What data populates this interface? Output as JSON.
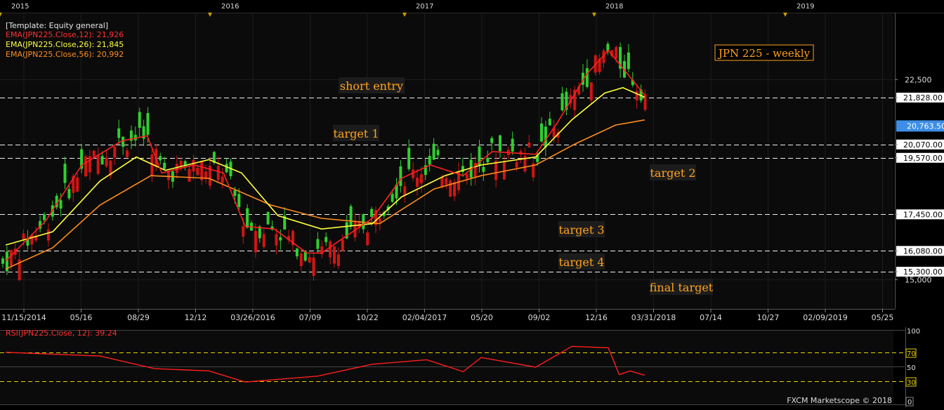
{
  "years": [
    {
      "label": "2015",
      "x": 0
    },
    {
      "label": "2016",
      "x": 299
    },
    {
      "label": "2017",
      "x": 576
    },
    {
      "label": "2018",
      "x": 846
    },
    {
      "label": "2019",
      "x": 1118
    }
  ],
  "legend": {
    "template": "[Template: Equity general]",
    "ema12": "EMA(JPN225.Close,12): 21,926",
    "ema26": "EMA(JPN225.Close,26): 21,845",
    "ema56": "EMA(JPN225.Close,56): 20,992"
  },
  "chart_title": "JPN 225 - weekly",
  "annotations": {
    "short_entry": "short entry",
    "target1": "target 1",
    "target2": "target 2",
    "target3": "target 3",
    "target4": "target 4",
    "final_target": "final target"
  },
  "price_axis": {
    "labels": [
      {
        "text": "22,500",
        "value": 22500
      },
      {
        "text": "21,828.00",
        "value": 21828
      },
      {
        "text": "20,070.00",
        "value": 20070
      },
      {
        "text": "19,570.00",
        "value": 19570
      },
      {
        "text": "17,450.00",
        "value": 17450
      },
      {
        "text": "16,080.00",
        "value": 16080
      },
      {
        "text": "15,300.00",
        "value": 15300
      },
      {
        "text": "15,000",
        "value": 15000
      }
    ],
    "current_price": "20,763.50"
  },
  "date_axis": [
    "11/15/2014",
    "05/16",
    "08/29",
    "12/12",
    "03/26/2016",
    "07/09",
    "10/22",
    "02/04/2017",
    "05/20",
    "09/02",
    "12/16",
    "03/31/2018",
    "07/14",
    "10/27",
    "02/09/2019",
    "05/25"
  ],
  "rsi": {
    "label": "RSI(JPN225.Close, 12): 39.24",
    "levels": [
      "100",
      "70",
      "50",
      "30",
      "0"
    ],
    "current": 39.24
  },
  "copyright": "FXCM Marketscope © 2018",
  "colors": {
    "bull": "#2fd02f",
    "bear": "#d21414",
    "ema12": "#ff2020",
    "ema26": "#ffff3c",
    "ema56": "#ff8c1e",
    "annotation": "#ffa21c",
    "current_price_bg": "#3d8ee6"
  },
  "chart_data": {
    "type": "line",
    "title": "JPN 225 - weekly",
    "x_range": [
      "11/15/2014",
      "05/25/2019"
    ],
    "ylim": [
      14400,
      24000
    ],
    "horizontal_levels": [
      {
        "name": "short entry",
        "value": 21828
      },
      {
        "name": "target 1",
        "value": 20070
      },
      {
        "name": "target 2",
        "value": 19570
      },
      {
        "name": "target 3",
        "value": 17450
      },
      {
        "name": "target 4",
        "value": 16080
      },
      {
        "name": "final target",
        "value": 15300
      }
    ],
    "series": [
      {
        "name": "EMA(JPN225.Close,12)",
        "last": 21926,
        "points": [
          [
            "11/15/2014",
            15700
          ],
          [
            "01/31/2015",
            17200
          ],
          [
            "04/11/2015",
            19300
          ],
          [
            "06/27/2015",
            20200
          ],
          [
            "08/15/2015",
            20400
          ],
          [
            "09/12/2015",
            19000
          ],
          [
            "11/14/2015",
            19300
          ],
          [
            "01/09/2016",
            19000
          ],
          [
            "02/20/2016",
            17000
          ],
          [
            "04/16/2016",
            16900
          ],
          [
            "06/18/2016",
            16000
          ],
          [
            "07/16/2016",
            16000
          ],
          [
            "10/22/2016",
            17300
          ],
          [
            "12/17/2016",
            18800
          ],
          [
            "02/11/2017",
            19300
          ],
          [
            "04/15/2017",
            18900
          ],
          [
            "06/10/2017",
            19800
          ],
          [
            "09/02/2017",
            19700
          ],
          [
            "10/14/2017",
            20900
          ],
          [
            "12/09/2017",
            22700
          ],
          [
            "01/20/2018",
            23600
          ],
          [
            "03/31/2018",
            21926
          ]
        ]
      },
      {
        "name": "EMA(JPN225.Close,26)",
        "last": 21845,
        "points": [
          [
            "11/15/2014",
            16300
          ],
          [
            "02/14/2015",
            16800
          ],
          [
            "05/16/2015",
            18700
          ],
          [
            "07/25/2015",
            19600
          ],
          [
            "09/19/2015",
            19100
          ],
          [
            "12/12/2015",
            19500
          ],
          [
            "02/13/2016",
            19000
          ],
          [
            "04/23/2016",
            17400
          ],
          [
            "07/16/2016",
            16900
          ],
          [
            "10/22/2016",
            17100
          ],
          [
            "12/17/2016",
            18100
          ],
          [
            "03/11/2017",
            18900
          ],
          [
            "05/20/2017",
            19300
          ],
          [
            "09/02/2017",
            19600
          ],
          [
            "11/11/2017",
            21000
          ],
          [
            "01/13/2018",
            22000
          ],
          [
            "02/17/2018",
            22200
          ],
          [
            "03/31/2018",
            21845
          ]
        ]
      },
      {
        "name": "EMA(JPN225.Close,56)",
        "last": 20992,
        "points": [
          [
            "11/15/2014",
            15400
          ],
          [
            "02/14/2015",
            16200
          ],
          [
            "05/16/2015",
            17800
          ],
          [
            "08/22/2015",
            18900
          ],
          [
            "12/12/2015",
            18800
          ],
          [
            "04/09/2016",
            17800
          ],
          [
            "07/16/2016",
            17300
          ],
          [
            "11/05/2016",
            17100
          ],
          [
            "02/18/2017",
            18400
          ],
          [
            "05/20/2017",
            18900
          ],
          [
            "09/02/2017",
            19300
          ],
          [
            "11/18/2017",
            20100
          ],
          [
            "02/03/2018",
            20800
          ],
          [
            "03/31/2018",
            20992
          ]
        ]
      },
      {
        "name": "RSI(JPN225.Close, 12)",
        "last": 39.24,
        "ylim": [
          0,
          100
        ],
        "points": [
          [
            "11/15/2014",
            70
          ],
          [
            "05/16/2015",
            65
          ],
          [
            "08/29/2015",
            48
          ],
          [
            "12/12/2015",
            45
          ],
          [
            "02/20/2016",
            30
          ],
          [
            "07/09/2016",
            38
          ],
          [
            "10/22/2016",
            54
          ],
          [
            "02/04/2017",
            60
          ],
          [
            "04/15/2017",
            44
          ],
          [
            "05/20/2017",
            63
          ],
          [
            "09/02/2017",
            50
          ],
          [
            "11/11/2017",
            78
          ],
          [
            "01/20/2018",
            76
          ],
          [
            "02/10/2018",
            40
          ],
          [
            "03/03/2018",
            45
          ],
          [
            "03/31/2018",
            39.24
          ]
        ]
      }
    ]
  }
}
